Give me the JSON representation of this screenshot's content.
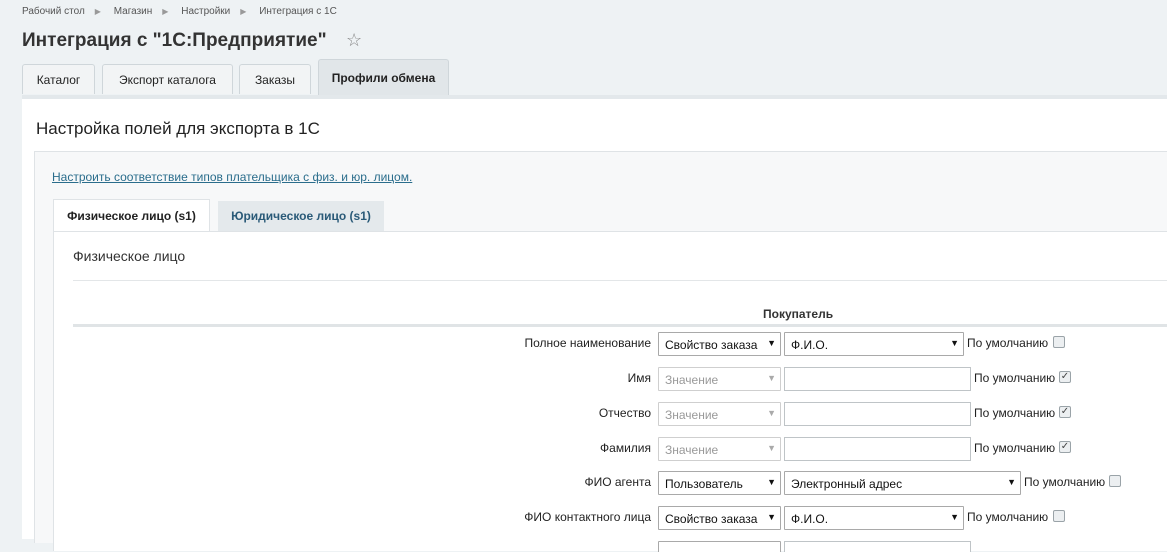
{
  "breadcrumbs": [
    "Рабочий стол",
    "Магазин",
    "Настройки",
    "Интеграция с 1С"
  ],
  "page": {
    "title": "Интеграция с \"1С:Предприятие\""
  },
  "top_tabs": [
    {
      "label": "Каталог"
    },
    {
      "label": "Экспорт каталога"
    },
    {
      "label": "Заказы"
    },
    {
      "label": "Профили обмена",
      "active": true
    }
  ],
  "panel": {
    "title": "Настройка полей для экспорта в 1С",
    "link": "Настроить соответствие типов плательщика с физ. и юр. лицом."
  },
  "sub_tabs": [
    {
      "label": "Физическое лицо (s1)",
      "active": true
    },
    {
      "label": "Юридическое лицо (s1)"
    }
  ],
  "section": {
    "title": "Физическое лицо",
    "header": "Покупатель",
    "default_label": "По умолчанию"
  },
  "rows": [
    {
      "label": "Полное наименование",
      "source": "Свойство заказа",
      "value": "Ф.И.О.",
      "default_checked": false
    },
    {
      "label": "Имя",
      "source": "Значение",
      "value": "",
      "default_checked": true
    },
    {
      "label": "Отчество",
      "source": "Значение",
      "value": "",
      "default_checked": true
    },
    {
      "label": "Фамилия",
      "source": "Значение",
      "value": "",
      "default_checked": true
    },
    {
      "label": "ФИО агента",
      "source": "Пользователь",
      "value": "Электронный адрес",
      "default_checked": false
    },
    {
      "label": "ФИО контактного лица",
      "source": "Свойство заказа",
      "value": "Ф.И.О.",
      "default_checked": false
    }
  ]
}
